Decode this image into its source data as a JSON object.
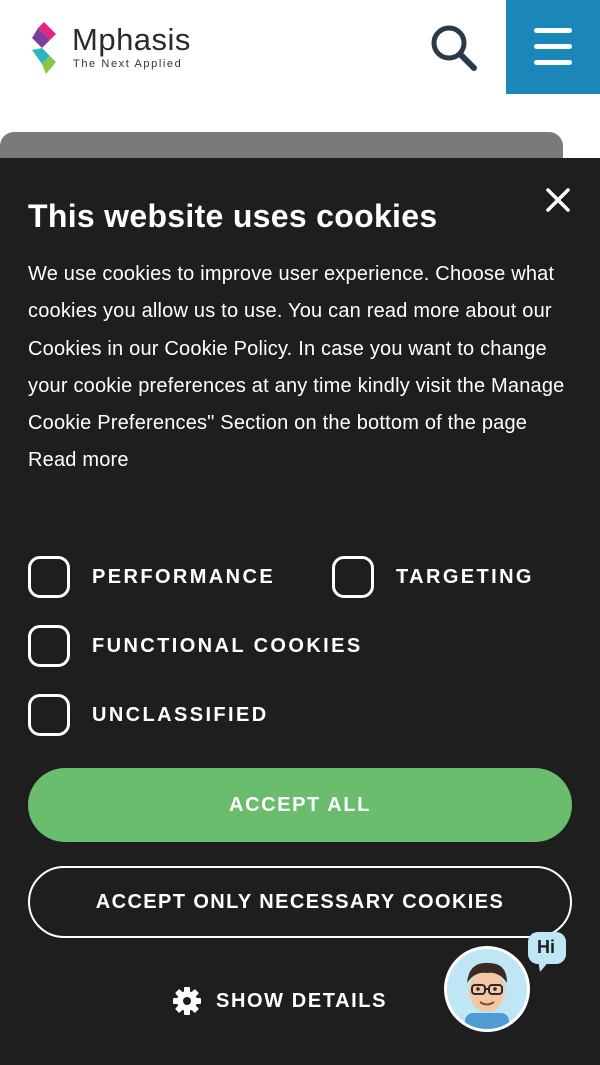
{
  "header": {
    "logo_name": "Mphasis",
    "logo_tagline": "The Next Applied",
    "search_icon": "search-icon",
    "menu_icon": "hamburger-menu-icon",
    "menu_bg_color": "#1b86b8"
  },
  "cookie_banner": {
    "title": "This website uses cookies",
    "description": "We use cookies to improve user experience. Choose what cookies you allow us to use. You can read more about our Cookies in our Cookie Policy. In case you want to change your cookie preferences at any time kindly visit the Manage Cookie Preferences\" Section on the bottom of the page",
    "read_more": "Read more",
    "close_icon": "close-icon",
    "options": {
      "performance": "PERFORMANCE",
      "targeting": "TARGETING",
      "functional": "FUNCTIONAL COOKIES",
      "unclassified": "UNCLASSIFIED"
    },
    "accept_all": "ACCEPT ALL",
    "accept_necessary": "ACCEPT ONLY NECESSARY COOKIES",
    "show_details": "SHOW DETAILS",
    "show_details_icon": "gear-icon",
    "panel_color": "#1e1e1f",
    "accept_color": "#6bbd6e"
  },
  "chatbot": {
    "greeting": "Hi",
    "icon": "chatbot-avatar-icon"
  }
}
